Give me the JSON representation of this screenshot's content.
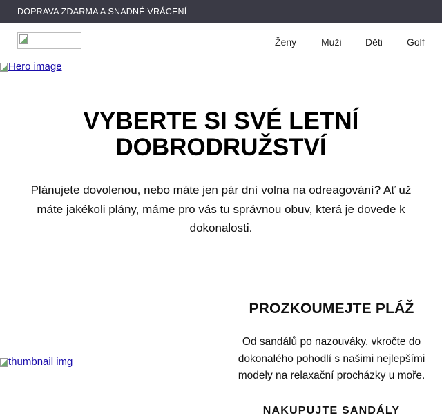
{
  "topbar": {
    "promo_text": "DOPRAVA ZDARMA A SNADNÉ VRÁCENÍ"
  },
  "header": {
    "logo": {
      "icon": "broken-image-icon"
    },
    "nav": [
      {
        "label": "Ženy"
      },
      {
        "label": "Muži"
      },
      {
        "label": "Děti"
      },
      {
        "label": "Golf"
      }
    ]
  },
  "hero": {
    "image_alt": "Hero image",
    "title_line1": "VYBERTE SI SVÉ LETNÍ",
    "title_line2": "DOBRODRUŽSTVÍ",
    "text": "Plánujete dovolenou, nebo máte jen pár dní volna na odreagování? Ať už máte jakékoli plány, máme pro vás tu správnou obuv, která je dovede k dokonalosti."
  },
  "section": {
    "thumbnail_alt": "thumbnail img",
    "title": "PROZKOUMEJTE PLÁŽ",
    "text": "Od sandálů po nazouváky, vkročte do dokonalého pohodlí s našimi nejlepšími modely na relaxační procházky u moře.",
    "cta_label": "NAKUPUJTE SANDÁLY"
  },
  "colors": {
    "topbar_bg": "#3a3a45",
    "link": "#1a0dab"
  }
}
